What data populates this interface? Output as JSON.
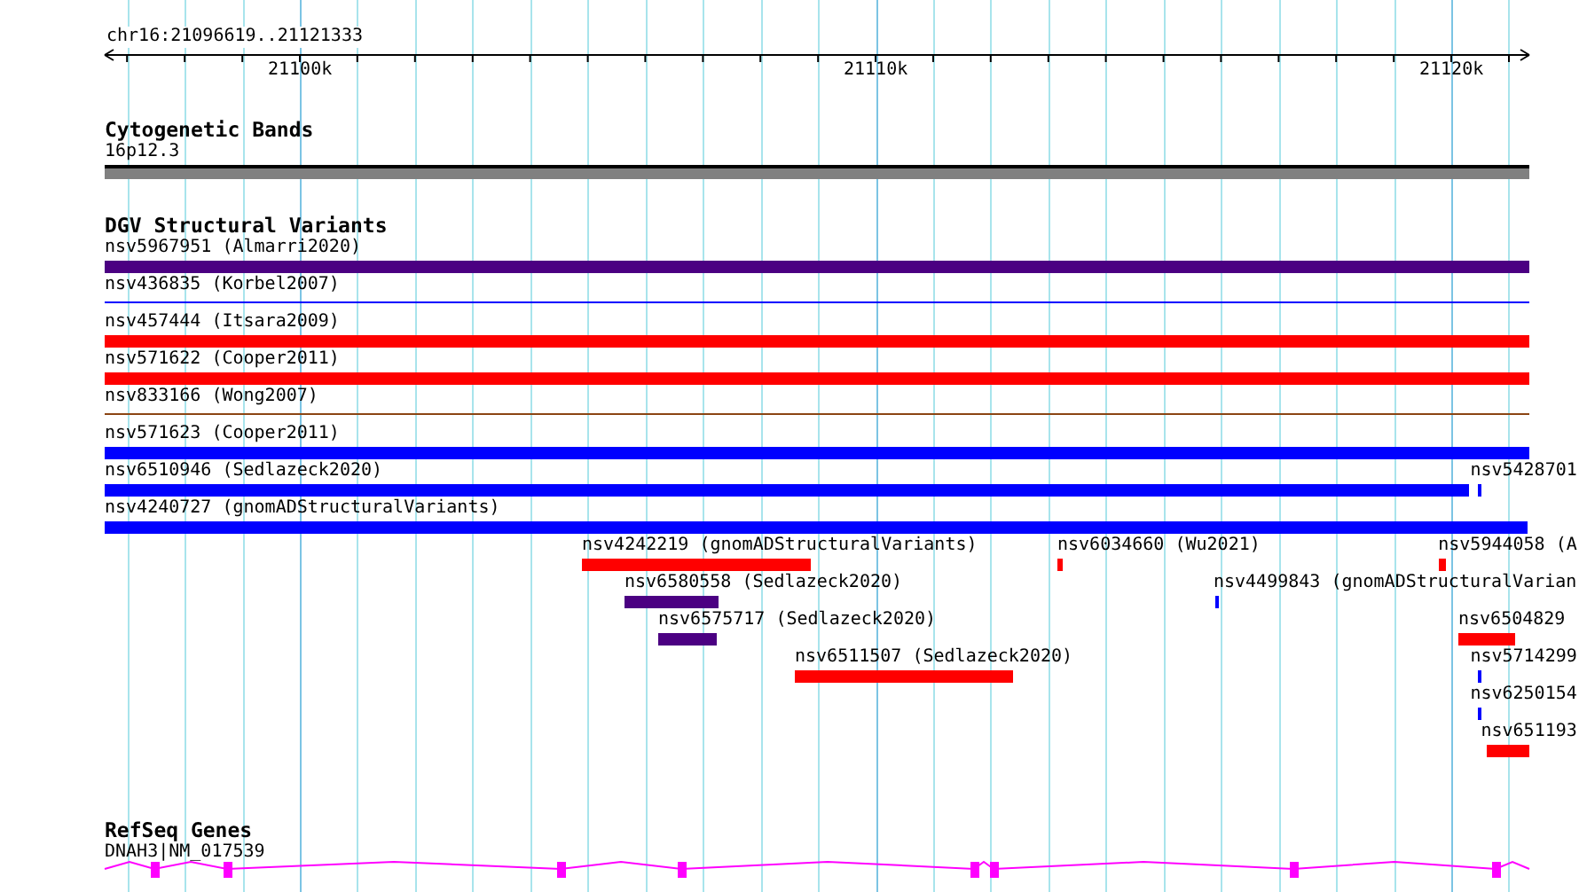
{
  "ruler": {
    "title": "chr16:21096619..21121333",
    "tick_labels": [
      "21100k",
      "21110k",
      "21120k"
    ]
  },
  "cytogenetic_bands": {
    "title": "Cytogenetic Bands",
    "band": "16p12.3"
  },
  "dgv_structural_variants": {
    "title": "DGV Structural Variants",
    "features": [
      {
        "label": "nsv5967951 (Almarri2020)",
        "kind": "bar",
        "color": "#4b0082"
      },
      {
        "label": "nsv436835 (Korbel2007)",
        "kind": "line",
        "color": "#0000ff"
      },
      {
        "label": "nsv457444 (Itsara2009)",
        "kind": "bar",
        "color": "#ff0000"
      },
      {
        "label": "nsv571622 (Cooper2011)",
        "kind": "bar",
        "color": "#ff0000"
      },
      {
        "label": "nsv833166 (Wong2007)",
        "kind": "line",
        "color": "#8b4513"
      },
      {
        "label": "nsv571623 (Cooper2011)",
        "kind": "bar",
        "color": "#0000ff"
      },
      {
        "label": "nsv6510946 (Sedlazeck2020)",
        "kind": "bar",
        "color": "#0000ff"
      },
      {
        "label": "nsv5428701",
        "kind": "bar",
        "color": "#0000ff"
      },
      {
        "label": "nsv4240727 (gnomADStructuralVariants)",
        "kind": "bar",
        "color": "#0000ff"
      },
      {
        "label": "nsv4242219 (gnomADStructuralVariants)",
        "kind": "bar",
        "color": "#ff0000"
      },
      {
        "label": "nsv6034660 (Wu2021)",
        "kind": "bar",
        "color": "#ff0000"
      },
      {
        "label": "nsv5944058 (A",
        "kind": "bar",
        "color": "#ff0000"
      },
      {
        "label": "nsv6580558 (Sedlazeck2020)",
        "kind": "bar",
        "color": "#4b0082"
      },
      {
        "label": "nsv4499843 (gnomADStructuralVarian",
        "kind": "bar",
        "color": "#0000ff"
      },
      {
        "label": "nsv6575717 (Sedlazeck2020)",
        "kind": "bar",
        "color": "#4b0082"
      },
      {
        "label": "nsv6504829",
        "kind": "bar",
        "color": "#ff0000"
      },
      {
        "label": "nsv6511507 (Sedlazeck2020)",
        "kind": "bar",
        "color": "#ff0000"
      },
      {
        "label": "nsv5714299",
        "kind": "bar",
        "color": "#0000ff"
      },
      {
        "label": "nsv6250154",
        "kind": "bar",
        "color": "#0000ff"
      },
      {
        "label": "nsv651193",
        "kind": "bar",
        "color": "#ff0000"
      }
    ]
  },
  "refseq_genes": {
    "title": "RefSeq Genes",
    "gene": "DNAH3|NM_017539"
  }
}
